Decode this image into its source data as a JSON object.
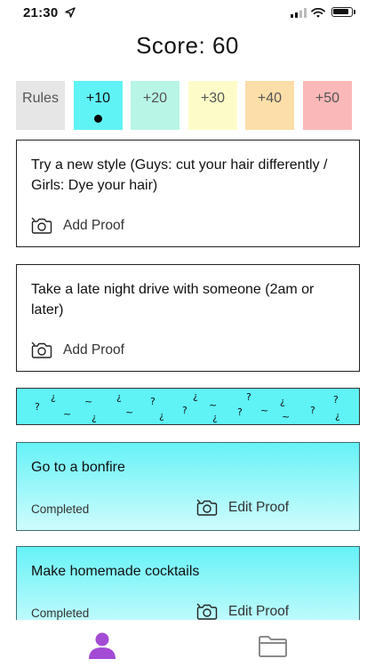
{
  "status": {
    "time": "21:30"
  },
  "score": {
    "label": "Score: 60"
  },
  "tabs": [
    {
      "label": "Rules",
      "color": "#e6e6e6",
      "selected": false
    },
    {
      "label": "+10",
      "color": "#5ff3f6",
      "selected": true
    },
    {
      "label": "+20",
      "color": "#b8f5e6",
      "selected": false
    },
    {
      "label": "+30",
      "color": "#fdfcc9",
      "selected": false
    },
    {
      "label": "+40",
      "color": "#fcdea8",
      "selected": false
    },
    {
      "label": "+50",
      "color": "#fbb8b8",
      "selected": false
    }
  ],
  "challenges": [
    {
      "title": "Try a new style (Guys: cut your hair differently / Girls: Dye your hair)",
      "action": "Add Proof"
    },
    {
      "title": "Take a late night drive with someone (2am or later)",
      "action": "Add Proof"
    }
  ],
  "completed": [
    {
      "title": "Go to a bonfire",
      "status": "Completed",
      "action": "Edit Proof"
    },
    {
      "title": "Make homemade cocktails",
      "status": "Completed",
      "action": "Edit Proof"
    }
  ],
  "colors": {
    "accent": "#5ff3f6",
    "profile_icon": "#a44bd6",
    "folder_icon": "#8a8a8a"
  },
  "nav": {
    "icons": [
      "person-icon",
      "folder-icon"
    ]
  }
}
